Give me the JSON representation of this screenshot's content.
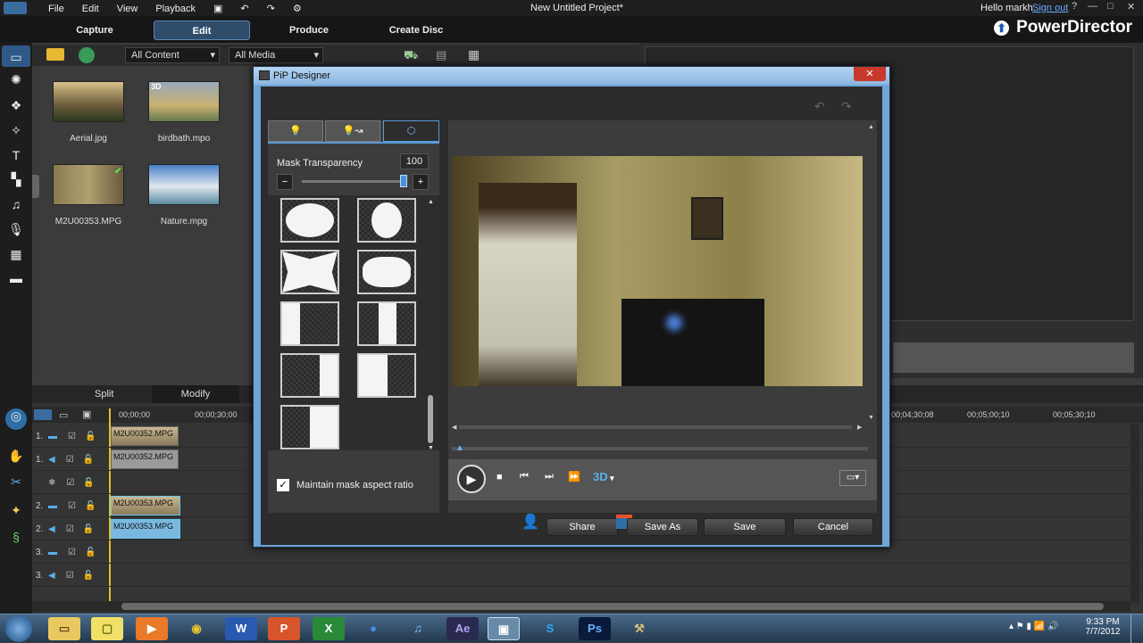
{
  "app": {
    "title": "New Untitled Project*",
    "brand": "PowerDirector",
    "greeting": "Hello markh",
    "signout": "Sign out"
  },
  "menu": [
    "File",
    "Edit",
    "View",
    "Playback"
  ],
  "modes": {
    "capture": "Capture",
    "edit": "Edit",
    "produce": "Produce",
    "create_disc": "Create Disc"
  },
  "library": {
    "filter1": "All Content",
    "filter2": "All Media",
    "items": [
      {
        "name": "Aerial.jpg"
      },
      {
        "name": "birdbath.mpo",
        "badge": "3D"
      },
      {
        "name": "M2U00353.MPG"
      },
      {
        "name": "Nature.mpg"
      }
    ]
  },
  "tabs_bottom": {
    "split": "Split",
    "modify": "Modify"
  },
  "timeline": {
    "ruler": [
      "00;00;00",
      "00;00;30;00",
      "00;04;30;08",
      "00;05;00;10",
      "00;05;30;10"
    ],
    "tracks": [
      {
        "num": "1.",
        "clip": "M2U00352.MPG"
      },
      {
        "num": "1.",
        "clip": "M2U00352.MPG"
      },
      {
        "num": "",
        "clip": ""
      },
      {
        "num": "2.",
        "clip": "M2U00353.MPG"
      },
      {
        "num": "2.",
        "clip": "M2U00353.MPG"
      },
      {
        "num": "3.",
        "clip": ""
      },
      {
        "num": "3.",
        "clip": ""
      }
    ]
  },
  "dialog": {
    "title": "PiP Designer",
    "mask_label": "Mask Transparency",
    "mask_value": "100",
    "maintain_label": "Maintain mask aspect ratio",
    "buttons": {
      "share": "Share",
      "save_as": "Save As",
      "save": "Save",
      "cancel": "Cancel"
    },
    "threed": "3D"
  },
  "clock": {
    "time": "9:33 PM",
    "date": "7/7/2012"
  },
  "taskbar_apps": [
    "start",
    "explorer",
    "sticky",
    "media",
    "chrome",
    "word",
    "powerpoint",
    "excel",
    "firefox",
    "itunes",
    "aftereffects",
    "powerdirector",
    "skype",
    "photoshop",
    "unknown"
  ]
}
